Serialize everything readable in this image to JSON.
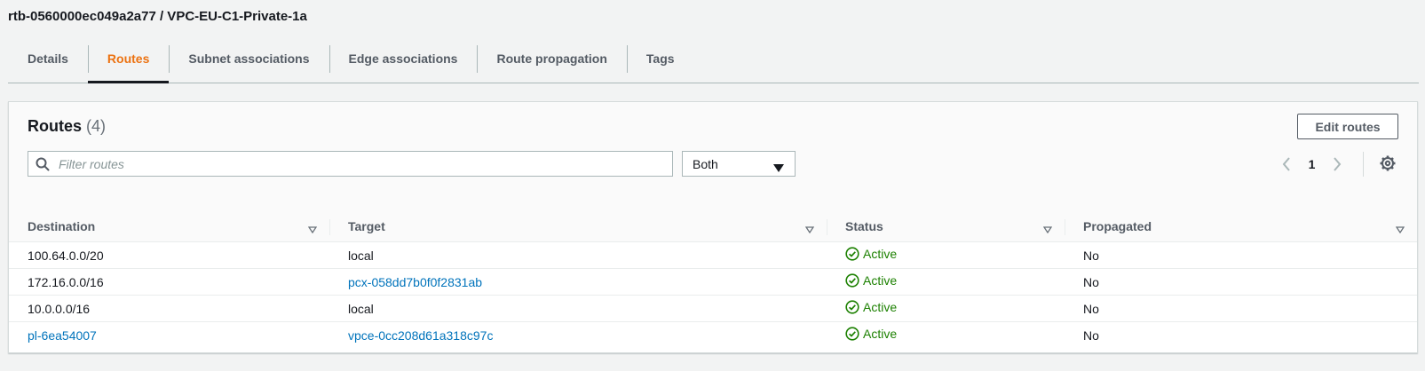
{
  "page": {
    "title": "rtb-0560000ec049a2a77 / VPC-EU-C1-Private-1a"
  },
  "tabs": [
    {
      "label": "Details",
      "active": false
    },
    {
      "label": "Routes",
      "active": true
    },
    {
      "label": "Subnet associations",
      "active": false
    },
    {
      "label": "Edge associations",
      "active": false
    },
    {
      "label": "Route propagation",
      "active": false
    },
    {
      "label": "Tags",
      "active": false
    }
  ],
  "routes": {
    "title": "Routes",
    "count": "(4)",
    "edit_button": "Edit routes",
    "filter_placeholder": "Filter routes",
    "filter_value": "",
    "select_value": "Both",
    "page_number": "1",
    "columns": [
      "Destination",
      "Target",
      "Status",
      "Propagated"
    ],
    "rows": [
      {
        "destination": "100.64.0.0/20",
        "destination_link": false,
        "target": "local",
        "target_link": false,
        "status": "Active",
        "propagated": "No"
      },
      {
        "destination": "172.16.0.0/16",
        "destination_link": false,
        "target": "pcx-058dd7b0f0f2831ab",
        "target_link": true,
        "status": "Active",
        "propagated": "No"
      },
      {
        "destination": "10.0.0.0/16",
        "destination_link": false,
        "target": "local",
        "target_link": false,
        "status": "Active",
        "propagated": "No"
      },
      {
        "destination": "pl-6ea54007",
        "destination_link": true,
        "target": "vpce-0cc208d61a318c97c",
        "target_link": true,
        "status": "Active",
        "propagated": "No"
      }
    ]
  },
  "icons": {
    "search": "search-icon",
    "caret": "caret-down-icon",
    "prev": "chevron-left-icon",
    "next": "chevron-right-icon",
    "settings": "gear-icon",
    "sort": "sort-icon",
    "status": "check-circle-icon"
  },
  "colors": {
    "accent": "#ec7211",
    "link": "#0073bb",
    "success": "#1d8102"
  }
}
